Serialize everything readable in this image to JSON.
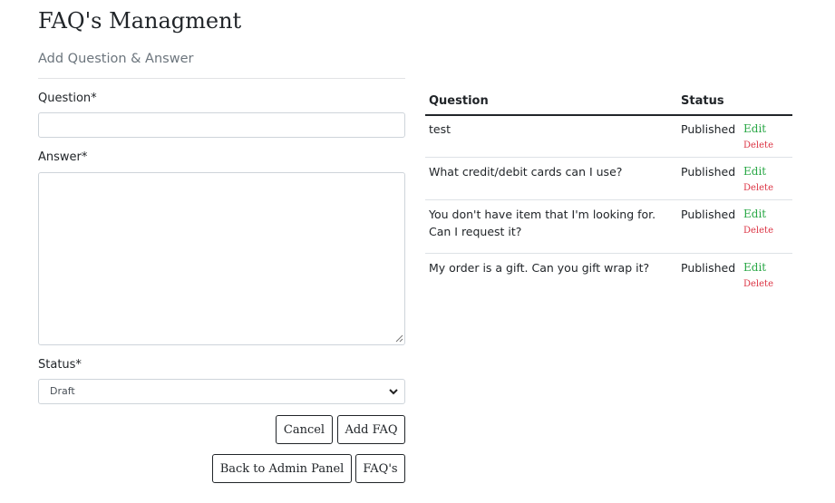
{
  "header": {
    "title": "FAQ's Managment",
    "subtitle": "Add Question & Answer"
  },
  "form": {
    "question_label": "Question*",
    "question_value": "",
    "answer_label": "Answer*",
    "answer_value": "",
    "status_label": "Status*",
    "status_value": "Draft",
    "cancel_label": "Cancel",
    "add_label": "Add FAQ",
    "back_label": "Back to Admin Panel",
    "faqs_label": "FAQ's"
  },
  "table": {
    "headers": {
      "question": "Question",
      "status": "Status"
    },
    "rows": [
      {
        "question": "test",
        "status": "Published",
        "edit": "Edit",
        "delete": "Delete"
      },
      {
        "question": "What credit/debit cards can I use?",
        "status": "Published",
        "edit": "Edit",
        "delete": "Delete"
      },
      {
        "question": "You don't have item that I'm looking for. Can I request it?",
        "status": "Published",
        "edit": "Edit",
        "delete": "Delete"
      },
      {
        "question": "My order is a gift. Can you gift wrap it?",
        "status": "Published",
        "edit": "Edit",
        "delete": "Delete"
      }
    ]
  },
  "colors": {
    "edit": "#28a745",
    "delete": "#dc3545",
    "subtitle": "#6c757d"
  }
}
